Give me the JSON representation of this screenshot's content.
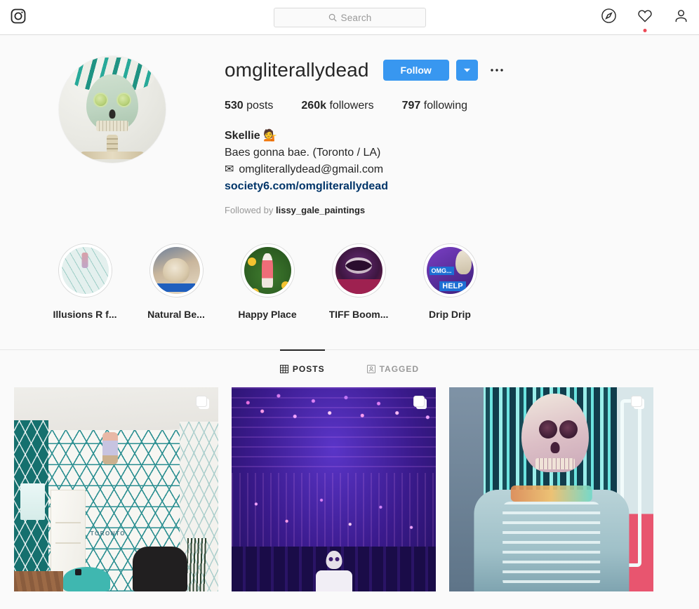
{
  "header": {
    "logo_icon": "instagram-logo-icon",
    "search": {
      "placeholder": "Search",
      "value": "",
      "icon": "search-icon"
    },
    "nav": [
      {
        "name": "explore",
        "icon": "compass-icon",
        "badge": false
      },
      {
        "name": "activity",
        "icon": "heart-icon",
        "badge": true
      },
      {
        "name": "profile",
        "icon": "person-icon",
        "badge": false
      }
    ]
  },
  "profile": {
    "avatar_alt": "skull-with-cucumber-eyes-avatar",
    "username": "omgliterallydead",
    "follow_label": "Follow",
    "follow_color": "#3897f0",
    "dropdown_icon": "chevron-down-icon",
    "options_icon": "ellipsis-icon",
    "stats": [
      {
        "value": "530",
        "label": "posts"
      },
      {
        "value": "260k",
        "label": "followers"
      },
      {
        "value": "797",
        "label": "following"
      }
    ],
    "bio": {
      "display_name": "Skellie",
      "name_emoji": "💁",
      "tagline": "Baes gonna bae. (Toronto / LA)",
      "email_icon": "✉",
      "email": "omgliterallydead@gmail.com",
      "website": "society6.com/omgliterallydead",
      "website_color": "#003569"
    },
    "followed_by": {
      "prefix": "Followed by",
      "users": "lissy_gale_paintings"
    }
  },
  "highlights": [
    {
      "label": "Illusions R f...",
      "art": "art-illusions"
    },
    {
      "label": "Natural Be...",
      "art": "art-natural"
    },
    {
      "label": "Happy Place",
      "art": "art-happy"
    },
    {
      "label": "TIFF Boom...",
      "art": "art-tiff"
    },
    {
      "label": "Drip Drip",
      "art": "art-drip"
    }
  ],
  "tabs": [
    {
      "label": "POSTS",
      "icon": "grid-icon",
      "active": true
    },
    {
      "label": "TAGGED",
      "icon": "tagged-icon",
      "active": false
    }
  ],
  "posts": [
    {
      "alt": "teal-hexagon-wallpaper-room-toronto",
      "carousel": true
    },
    {
      "alt": "purple-infinity-mirror-room-skeleton",
      "carousel": true
    },
    {
      "alt": "neon-skeleton-in-tshirt",
      "carousel": true
    }
  ]
}
